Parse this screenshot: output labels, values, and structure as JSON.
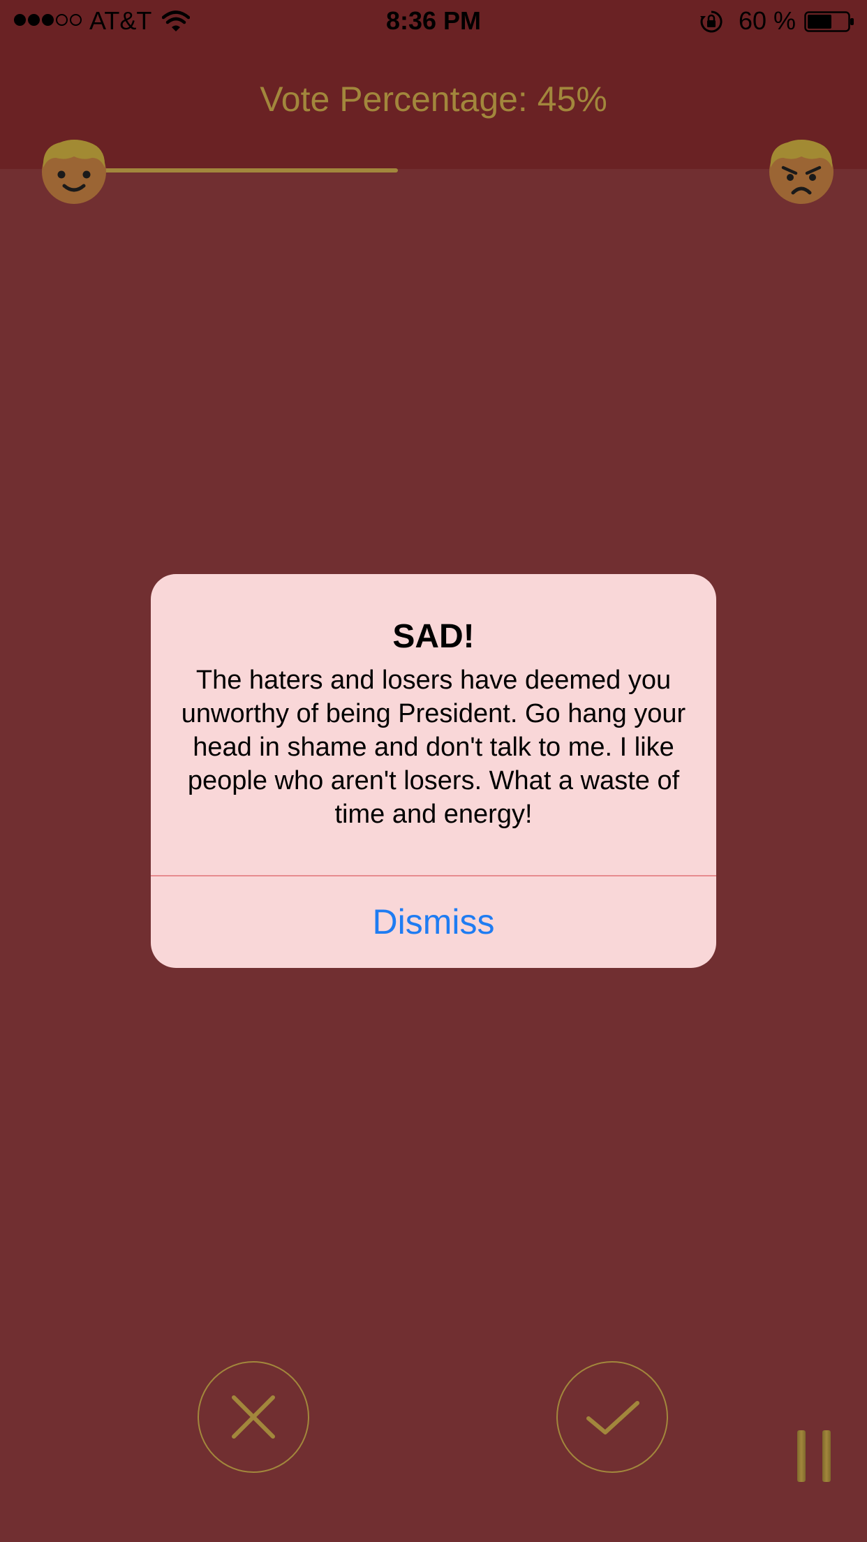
{
  "status_bar": {
    "signal_bars_filled": 3,
    "signal_bars_total": 5,
    "carrier": "AT&T",
    "wifi_icon": "wifi-icon",
    "time": "8:36 PM",
    "orientation_lock_icon": "orientation-lock-icon",
    "battery_text": "60 %",
    "battery_level": 0.6
  },
  "header": {
    "title": "Vote Percentage: 45%",
    "vote_fraction": 0.45,
    "left_face_icon": "happy-face-icon",
    "right_face_icon": "angry-face-icon"
  },
  "alert": {
    "title": "SAD!",
    "message": "The haters and losers have deemed you unworthy of being President. Go hang your head in shame and don't talk to me. I like people who aren't losers. What a waste of time and energy!",
    "dismiss_label": "Dismiss"
  },
  "controls": {
    "reject_icon": "close-icon",
    "accept_icon": "checkmark-icon",
    "pause_icon": "pause-icon"
  },
  "colors": {
    "background": "#712f31",
    "header_background": "#6a2224",
    "accent_gold": "#a2873c",
    "alert_background": "#f9d7d8",
    "alert_button_text": "#1f7cf2"
  }
}
